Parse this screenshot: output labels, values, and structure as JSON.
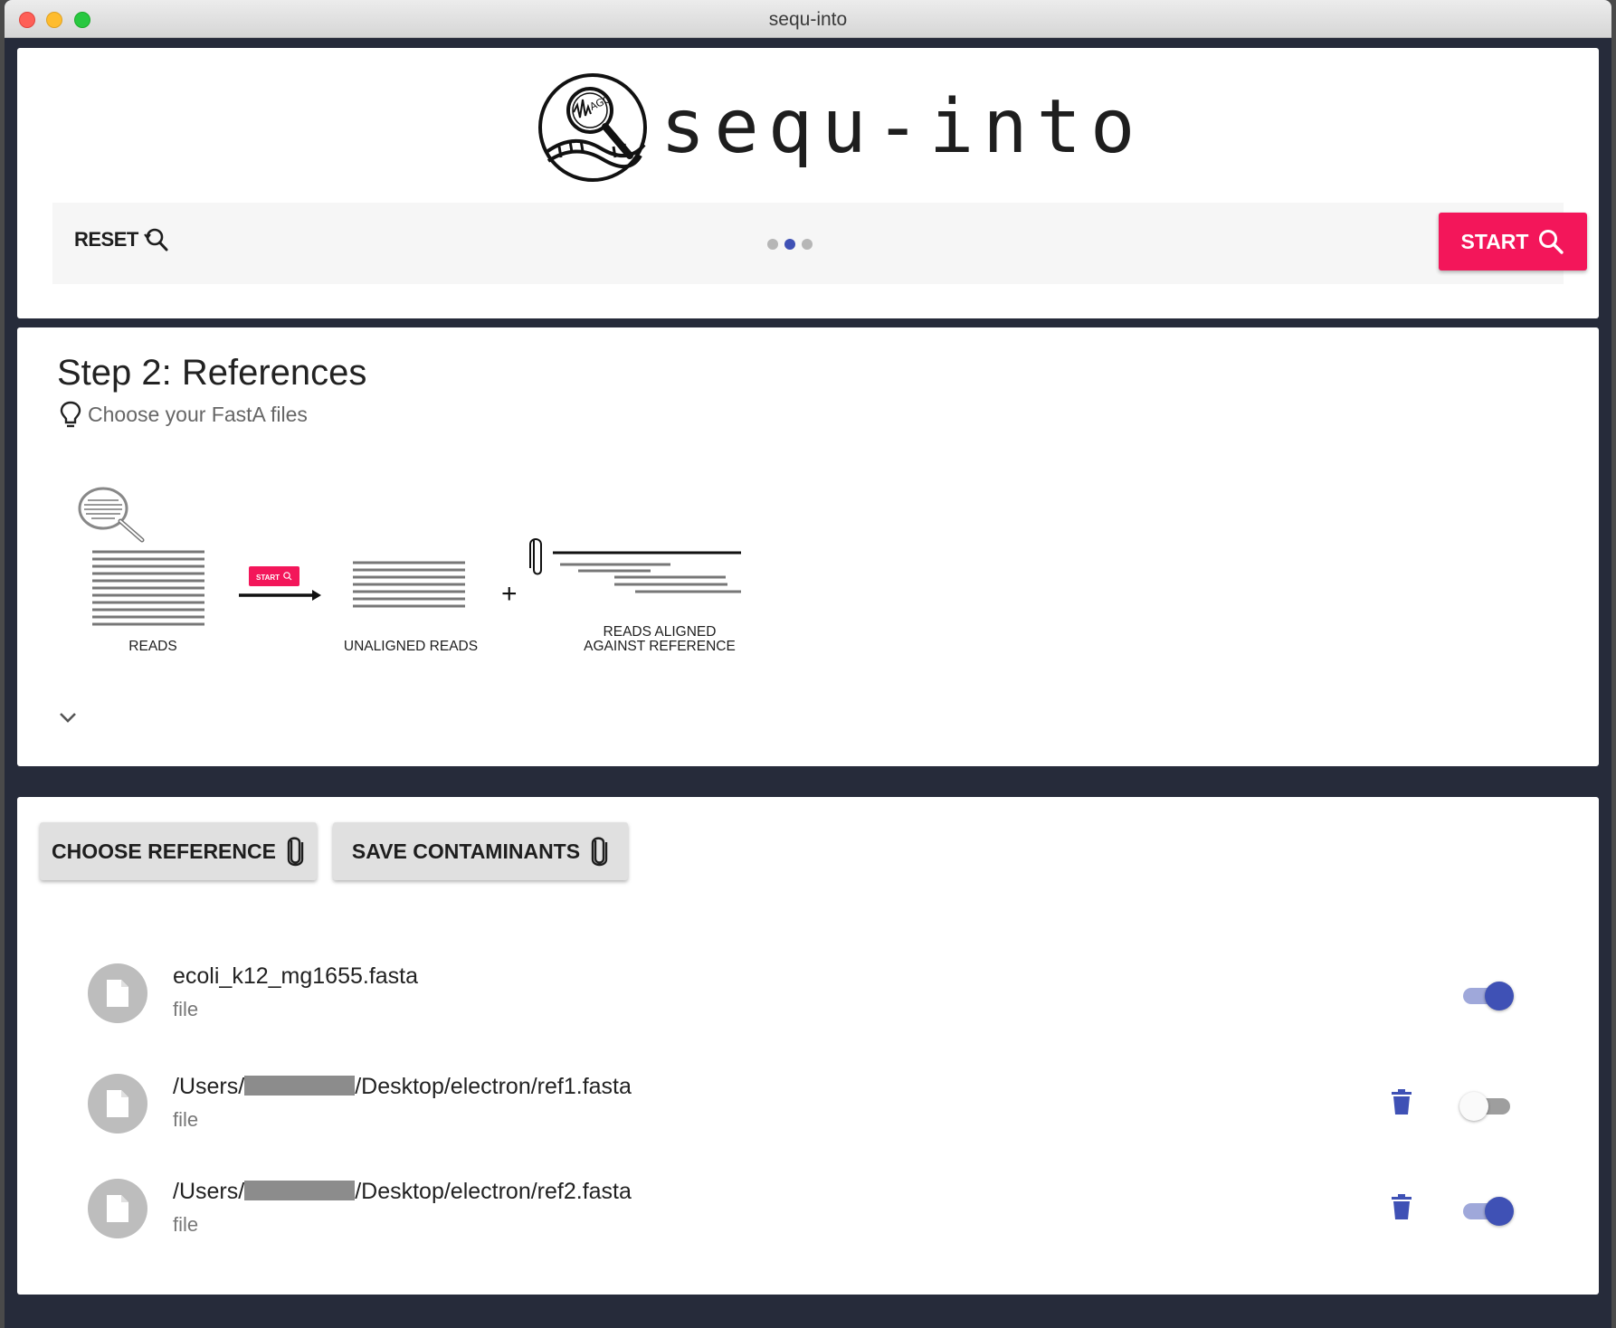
{
  "window": {
    "title": "sequ-into"
  },
  "header": {
    "logo_text": "sequ-into",
    "logo_badge_text": "AGC",
    "reset_label": "RESET",
    "start_label": "START",
    "stepper": {
      "count": 3,
      "active_index": 1
    },
    "accent_color": "#f3165a",
    "primary_color": "#3f51b5"
  },
  "step": {
    "title": "Step 2: References",
    "hint": "Choose your FastA files",
    "diagram": {
      "reads_label": "READS",
      "start_mini_label": "START",
      "unaligned_label": "UNALIGNED READS",
      "plus": "+",
      "aligned_label_line1": "READS ALIGNED",
      "aligned_label_line2": "AGAINST REFERENCE"
    }
  },
  "files_panel": {
    "choose_reference_label": "CHOOSE REFERENCE",
    "save_contaminants_label": "SAVE CONTAMINANTS",
    "files": [
      {
        "name_prefix": "ecoli_k12_mg1655.fasta",
        "name_suffix": "",
        "redacted": false,
        "type": "file",
        "deletable": false,
        "enabled": true
      },
      {
        "name_prefix": "/Users/",
        "name_suffix": "/Desktop/electron/ref1.fasta",
        "redacted": true,
        "type": "file",
        "deletable": true,
        "enabled": false
      },
      {
        "name_prefix": "/Users/",
        "name_suffix": "/Desktop/electron/ref2.fasta",
        "redacted": true,
        "type": "file",
        "deletable": true,
        "enabled": true
      }
    ]
  }
}
